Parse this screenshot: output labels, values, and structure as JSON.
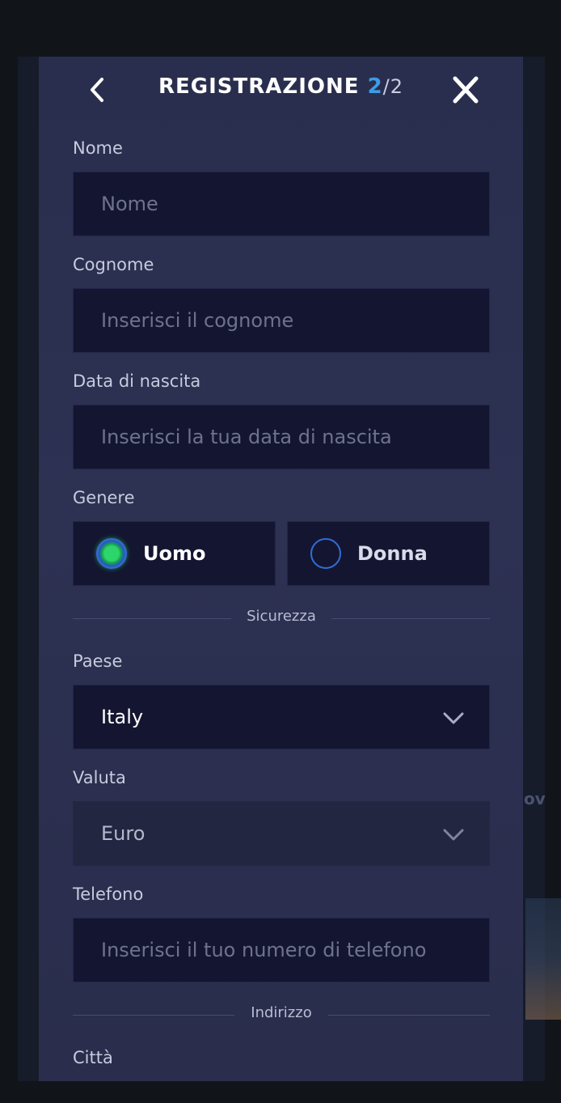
{
  "header": {
    "title": "REGISTRAZIONE",
    "step_current": "2",
    "step_separator": "/",
    "step_total": "2"
  },
  "form": {
    "nome": {
      "label": "Nome",
      "placeholder": "Nome"
    },
    "cognome": {
      "label": "Cognome",
      "placeholder": "Inserisci il cognome"
    },
    "data_nascita": {
      "label": "Data di nascita",
      "placeholder": "Inserisci la tua data di nascita"
    },
    "genere": {
      "label": "Genere",
      "options": [
        "Uomo",
        "Donna"
      ],
      "selected": "Uomo"
    },
    "section_sicurezza": "Sicurezza",
    "paese": {
      "label": "Paese",
      "value": "Italy"
    },
    "valuta": {
      "label": "Valuta",
      "value": "Euro"
    },
    "telefono": {
      "label": "Telefono",
      "placeholder": "Inserisci il tuo numero di telefono"
    },
    "section_indirizzo": "Indirizzo",
    "citta": {
      "label": "Città"
    }
  },
  "background": {
    "peek_text": "ov"
  },
  "colors": {
    "accent_blue": "#3d9ce6",
    "radio_selected_green": "#2dd56b",
    "modal_bg": "#2b2f50",
    "field_bg": "#141631"
  },
  "icons": {
    "back": "chevron-left-icon",
    "close": "close-icon",
    "dropdown": "chevron-down-icon"
  }
}
